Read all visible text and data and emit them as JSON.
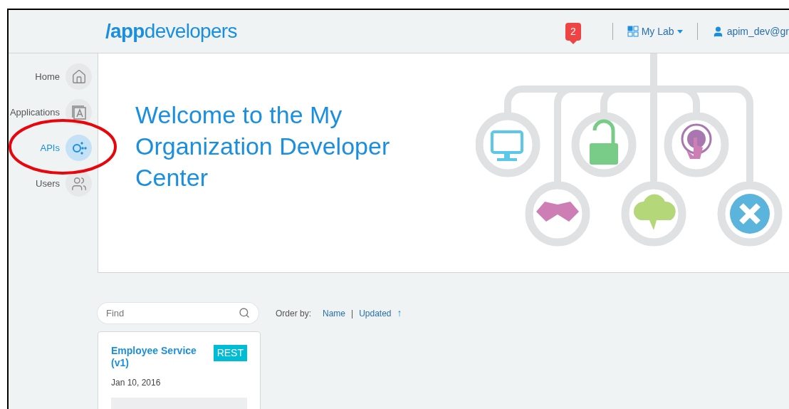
{
  "header": {
    "logo": "**/app**developers",
    "notification_count": "2",
    "lab_menu": "My Lab",
    "user": "apim_dev@gr"
  },
  "sidebar": {
    "items": [
      {
        "label": "Home",
        "kind": "home",
        "selected": false
      },
      {
        "label": "Applications",
        "kind": "applications",
        "selected": false
      },
      {
        "label": "APIs",
        "kind": "apis",
        "selected": true
      },
      {
        "label": "Users",
        "kind": "users",
        "selected": false
      }
    ]
  },
  "hero": {
    "title": "Welcome to the My Organization Developer Center"
  },
  "search": {
    "placeholder": "Find"
  },
  "order_by": {
    "label": "Order by:",
    "options": [
      "Name",
      "Updated"
    ],
    "separator": "|",
    "direction": "↑"
  },
  "cards": [
    {
      "title": "Employee Service (v1)",
      "badge": "REST",
      "date": "Jan 10, 2016"
    }
  ]
}
